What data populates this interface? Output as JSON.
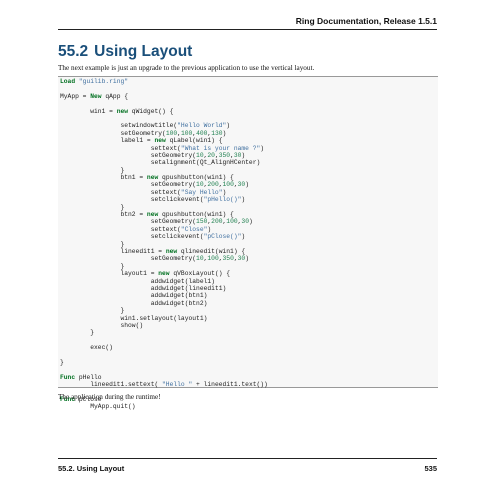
{
  "header": {
    "doc_title": "Ring Documentation, Release 1.5.1"
  },
  "section": {
    "number": "55.2",
    "title": "Using Layout"
  },
  "intro_text": "The next example is just an upgrade to the previous application to use the vertical layout.",
  "code_lines": [
    [
      [
        "kw",
        "Load"
      ],
      [
        "t",
        " "
      ],
      [
        "str",
        "\"guilib.ring\""
      ]
    ],
    [],
    [
      [
        "t",
        "MyApp = "
      ],
      [
        "kw",
        "New"
      ],
      [
        "t",
        " qApp {"
      ]
    ],
    [],
    [
      [
        "t",
        "        win1 = "
      ],
      [
        "kw",
        "new"
      ],
      [
        "t",
        " qWidget() {"
      ]
    ],
    [],
    [
      [
        "t",
        "                setwindowtitle("
      ],
      [
        "str",
        "\"Hello World\""
      ],
      [
        "t",
        ")"
      ]
    ],
    [
      [
        "t",
        "                setGeometry("
      ],
      [
        "num",
        "100"
      ],
      [
        "t",
        ","
      ],
      [
        "num",
        "100"
      ],
      [
        "t",
        ","
      ],
      [
        "num",
        "400"
      ],
      [
        "t",
        ","
      ],
      [
        "num",
        "130"
      ],
      [
        "t",
        ")"
      ]
    ],
    [
      [
        "t",
        "                label1 = "
      ],
      [
        "kw",
        "new"
      ],
      [
        "t",
        " qLabel(win1) {"
      ]
    ],
    [
      [
        "t",
        "                        settext("
      ],
      [
        "str",
        "\"What is your name ?\""
      ],
      [
        "t",
        ")"
      ]
    ],
    [
      [
        "t",
        "                        setGeometry("
      ],
      [
        "num",
        "10"
      ],
      [
        "t",
        ","
      ],
      [
        "num",
        "20"
      ],
      [
        "t",
        ","
      ],
      [
        "num",
        "350"
      ],
      [
        "t",
        ","
      ],
      [
        "num",
        "30"
      ],
      [
        "t",
        ")"
      ]
    ],
    [
      [
        "t",
        "                        setalignment(Qt_AlignHCenter)"
      ]
    ],
    [
      [
        "t",
        "                }"
      ]
    ],
    [
      [
        "t",
        "                btn1 = "
      ],
      [
        "kw",
        "new"
      ],
      [
        "t",
        " qpushbutton(win1) {"
      ]
    ],
    [
      [
        "t",
        "                        setGeometry("
      ],
      [
        "num",
        "10"
      ],
      [
        "t",
        ","
      ],
      [
        "num",
        "200"
      ],
      [
        "t",
        ","
      ],
      [
        "num",
        "100"
      ],
      [
        "t",
        ","
      ],
      [
        "num",
        "30"
      ],
      [
        "t",
        ")"
      ]
    ],
    [
      [
        "t",
        "                        settext("
      ],
      [
        "str",
        "\"Say Hello\""
      ],
      [
        "t",
        ")"
      ]
    ],
    [
      [
        "t",
        "                        setclickevent("
      ],
      [
        "str",
        "\"pHello()\""
      ],
      [
        "t",
        ")"
      ]
    ],
    [
      [
        "t",
        "                }"
      ]
    ],
    [
      [
        "t",
        "                btn2 = "
      ],
      [
        "kw",
        "new"
      ],
      [
        "t",
        " qpushbutton(win1) {"
      ]
    ],
    [
      [
        "t",
        "                        setGeometry("
      ],
      [
        "num",
        "150"
      ],
      [
        "t",
        ","
      ],
      [
        "num",
        "200"
      ],
      [
        "t",
        ","
      ],
      [
        "num",
        "100"
      ],
      [
        "t",
        ","
      ],
      [
        "num",
        "30"
      ],
      [
        "t",
        ")"
      ]
    ],
    [
      [
        "t",
        "                        settext("
      ],
      [
        "str",
        "\"Close\""
      ],
      [
        "t",
        ")"
      ]
    ],
    [
      [
        "t",
        "                        setclickevent("
      ],
      [
        "str",
        "\"pClose()\""
      ],
      [
        "t",
        ")"
      ]
    ],
    [
      [
        "t",
        "                }"
      ]
    ],
    [
      [
        "t",
        "                lineedit1 = "
      ],
      [
        "kw",
        "new"
      ],
      [
        "t",
        " qlineedit(win1) {"
      ]
    ],
    [
      [
        "t",
        "                        setGeometry("
      ],
      [
        "num",
        "10"
      ],
      [
        "t",
        ","
      ],
      [
        "num",
        "100"
      ],
      [
        "t",
        ","
      ],
      [
        "num",
        "350"
      ],
      [
        "t",
        ","
      ],
      [
        "num",
        "30"
      ],
      [
        "t",
        ")"
      ]
    ],
    [
      [
        "t",
        "                }"
      ]
    ],
    [
      [
        "t",
        "                layout1 = "
      ],
      [
        "kw",
        "new"
      ],
      [
        "t",
        " qVBoxLayout() {"
      ]
    ],
    [
      [
        "t",
        "                        addwidget(label1)"
      ]
    ],
    [
      [
        "t",
        "                        addwidget(lineedit1)"
      ]
    ],
    [
      [
        "t",
        "                        addwidget(btn1)"
      ]
    ],
    [
      [
        "t",
        "                        addwidget(btn2)"
      ]
    ],
    [
      [
        "t",
        "                }"
      ]
    ],
    [
      [
        "t",
        "                win1.setlayout(layout1)"
      ]
    ],
    [
      [
        "t",
        "                show()"
      ]
    ],
    [
      [
        "t",
        "        }"
      ]
    ],
    [],
    [
      [
        "t",
        "        exec()"
      ]
    ],
    [],
    [
      [
        "t",
        "}"
      ]
    ],
    [],
    [
      [
        "kw",
        "Func"
      ],
      [
        "t",
        " pHello"
      ]
    ],
    [
      [
        "t",
        "        lineedit1.settext( "
      ],
      [
        "str",
        "\"Hello \""
      ],
      [
        "t",
        " + lineedit1.text())"
      ]
    ],
    [],
    [
      [
        "kw",
        "Func"
      ],
      [
        "t",
        " pClose"
      ]
    ],
    [
      [
        "t",
        "        MyApp.quit()"
      ]
    ]
  ],
  "after_text": "The application during the runtime!",
  "footer": {
    "label": "55.2.  Using Layout",
    "page": "535"
  }
}
